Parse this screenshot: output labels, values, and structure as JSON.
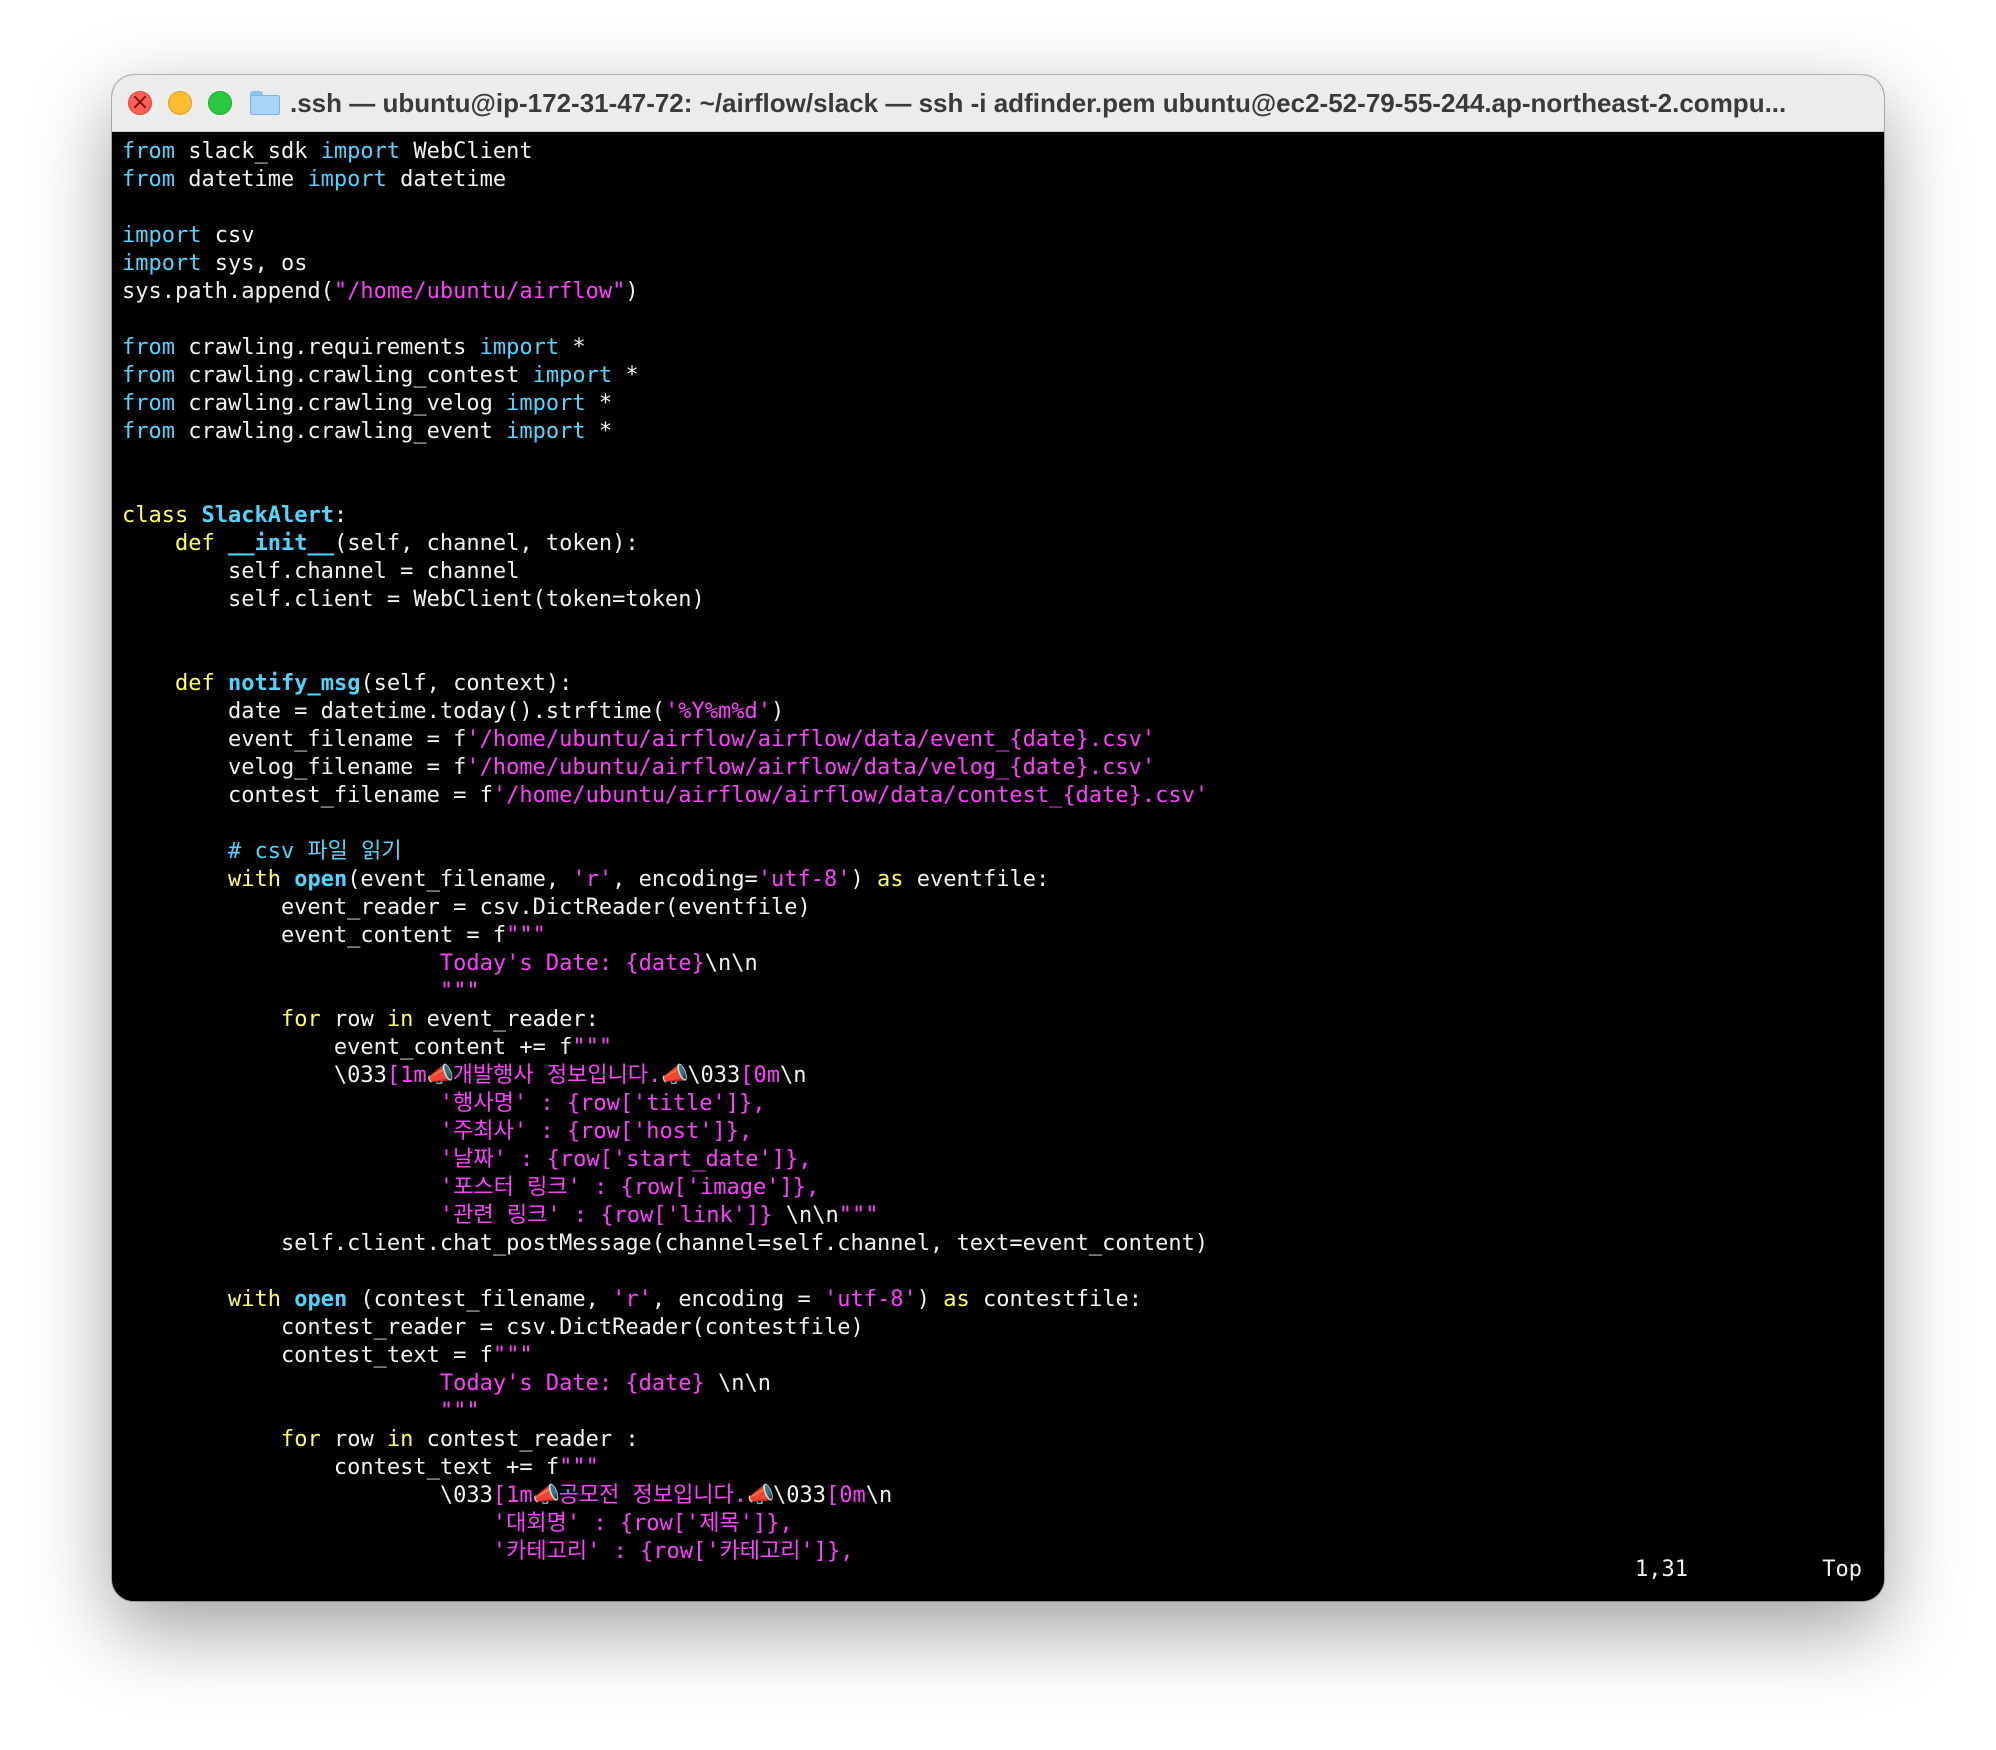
{
  "window": {
    "title": ".ssh — ubuntu@ip-172-31-47-72: ~/airflow/slack — ssh -i adfinder.pem ubuntu@ec2-52-79-55-244.ap-northeast-2.compu..."
  },
  "status": {
    "cursor": "1,31",
    "position": "Top"
  },
  "code": [
    [
      {
        "t": "from",
        "c": "kw"
      },
      {
        "t": " slack_sdk "
      },
      {
        "t": "import",
        "c": "kw"
      },
      {
        "t": " WebClient"
      }
    ],
    [
      {
        "t": "from",
        "c": "kw"
      },
      {
        "t": " datetime "
      },
      {
        "t": "import",
        "c": "kw"
      },
      {
        "t": " datetime"
      }
    ],
    [],
    [
      {
        "t": "import",
        "c": "kw"
      },
      {
        "t": " csv"
      }
    ],
    [
      {
        "t": "import",
        "c": "kw"
      },
      {
        "t": " sys, os"
      }
    ],
    [
      {
        "t": "sys.path.append("
      },
      {
        "t": "\"/home/ubuntu/airflow\"",
        "c": "str"
      },
      {
        "t": ")"
      }
    ],
    [],
    [
      {
        "t": "from",
        "c": "kw"
      },
      {
        "t": " crawling.requirements "
      },
      {
        "t": "import",
        "c": "kw"
      },
      {
        "t": " *"
      }
    ],
    [
      {
        "t": "from",
        "c": "kw"
      },
      {
        "t": " crawling.crawling_contest "
      },
      {
        "t": "import",
        "c": "kw"
      },
      {
        "t": " *"
      }
    ],
    [
      {
        "t": "from",
        "c": "kw"
      },
      {
        "t": " crawling.crawling_velog "
      },
      {
        "t": "import",
        "c": "kw"
      },
      {
        "t": " *"
      }
    ],
    [
      {
        "t": "from",
        "c": "kw"
      },
      {
        "t": " crawling.crawling_event "
      },
      {
        "t": "import",
        "c": "kw"
      },
      {
        "t": " *"
      }
    ],
    [],
    [],
    [
      {
        "t": "class",
        "c": "ky"
      },
      {
        "t": " "
      },
      {
        "t": "SlackAlert",
        "c": "cls"
      },
      {
        "t": ":"
      }
    ],
    [
      {
        "t": "    "
      },
      {
        "t": "def",
        "c": "ky"
      },
      {
        "t": " "
      },
      {
        "t": "__init__",
        "c": "cls"
      },
      {
        "t": "(self, channel, token):"
      }
    ],
    [
      {
        "t": "        self.channel = channel"
      }
    ],
    [
      {
        "t": "        self.client = WebClient(token=token)"
      }
    ],
    [],
    [],
    [
      {
        "t": "    "
      },
      {
        "t": "def",
        "c": "ky"
      },
      {
        "t": " "
      },
      {
        "t": "notify_msg",
        "c": "cls"
      },
      {
        "t": "(self, context):"
      }
    ],
    [
      {
        "t": "        date = datetime.today().strftime("
      },
      {
        "t": "'%Y%m%d'",
        "c": "str"
      },
      {
        "t": ")"
      }
    ],
    [
      {
        "t": "        event_filename = f"
      },
      {
        "t": "'/home/ubuntu/airflow/airflow/data/event_{date}.csv'",
        "c": "str"
      }
    ],
    [
      {
        "t": "        velog_filename = f"
      },
      {
        "t": "'/home/ubuntu/airflow/airflow/data/velog_{date}.csv'",
        "c": "str"
      }
    ],
    [
      {
        "t": "        contest_filename = f"
      },
      {
        "t": "'/home/ubuntu/airflow/airflow/data/contest_{date}.csv'",
        "c": "str"
      }
    ],
    [],
    [
      {
        "t": "        "
      },
      {
        "t": "# csv 파일 읽기",
        "c": "cm"
      }
    ],
    [
      {
        "t": "        "
      },
      {
        "t": "with",
        "c": "ky"
      },
      {
        "t": " "
      },
      {
        "t": "open",
        "c": "cls"
      },
      {
        "t": "(event_filename, "
      },
      {
        "t": "'r'",
        "c": "str"
      },
      {
        "t": ", encoding="
      },
      {
        "t": "'utf-8'",
        "c": "str"
      },
      {
        "t": ") "
      },
      {
        "t": "as",
        "c": "ky"
      },
      {
        "t": " eventfile:"
      }
    ],
    [
      {
        "t": "            event_reader = csv.DictReader(eventfile)"
      }
    ],
    [
      {
        "t": "            event_content = f"
      },
      {
        "t": "\"\"\"",
        "c": "str"
      }
    ],
    [
      {
        "t": "                        "
      },
      {
        "t": "Today's Date: {date}",
        "c": "str"
      },
      {
        "t": "\\n\\n"
      }
    ],
    [
      {
        "t": "                        "
      },
      {
        "t": "\"\"\"",
        "c": "str"
      }
    ],
    [
      {
        "t": "            "
      },
      {
        "t": "for",
        "c": "ky"
      },
      {
        "t": " row "
      },
      {
        "t": "in",
        "c": "ky"
      },
      {
        "t": " event_reader:"
      }
    ],
    [
      {
        "t": "                event_content += f"
      },
      {
        "t": "\"\"\"",
        "c": "str"
      }
    ],
    [
      {
        "t": "                \\033"
      },
      {
        "t": "[1m",
        "c": "str"
      },
      {
        "t": "📣",
        "c": "emoji"
      },
      {
        "t": "개발행사 정보입니다.",
        "c": "str"
      },
      {
        "t": "📣",
        "c": "emoji"
      },
      {
        "t": "\\033"
      },
      {
        "t": "[0m",
        "c": "str"
      },
      {
        "t": "\\n"
      }
    ],
    [
      {
        "t": "                        "
      },
      {
        "t": "'행사명' : {row['title']},",
        "c": "str"
      }
    ],
    [
      {
        "t": "                        "
      },
      {
        "t": "'주최사' : {row['host']},",
        "c": "str"
      }
    ],
    [
      {
        "t": "                        "
      },
      {
        "t": "'날짜' : {row['start_date']},",
        "c": "str"
      }
    ],
    [
      {
        "t": "                        "
      },
      {
        "t": "'포스터 링크' : {row['image']},",
        "c": "str"
      }
    ],
    [
      {
        "t": "                        "
      },
      {
        "t": "'관련 링크' : {row['link']}",
        "c": "str"
      },
      {
        "t": " \\n\\n"
      },
      {
        "t": "\"\"\"",
        "c": "str"
      }
    ],
    [
      {
        "t": "            self.client.chat_postMessage(channel=self.channel, text=event_content)"
      }
    ],
    [],
    [
      {
        "t": "        "
      },
      {
        "t": "with",
        "c": "ky"
      },
      {
        "t": " "
      },
      {
        "t": "open",
        "c": "cls"
      },
      {
        "t": " (contest_filename, "
      },
      {
        "t": "'r'",
        "c": "str"
      },
      {
        "t": ", encoding = "
      },
      {
        "t": "'utf-8'",
        "c": "str"
      },
      {
        "t": ") "
      },
      {
        "t": "as",
        "c": "ky"
      },
      {
        "t": " contestfile:"
      }
    ],
    [
      {
        "t": "            contest_reader = csv.DictReader(contestfile)"
      }
    ],
    [
      {
        "t": "            contest_text = f"
      },
      {
        "t": "\"\"\"",
        "c": "str"
      }
    ],
    [
      {
        "t": "                        "
      },
      {
        "t": "Today's Date: {date}",
        "c": "str"
      },
      {
        "t": " \\n\\n"
      }
    ],
    [
      {
        "t": "                        "
      },
      {
        "t": "\"\"\"",
        "c": "str"
      }
    ],
    [
      {
        "t": "            "
      },
      {
        "t": "for",
        "c": "ky"
      },
      {
        "t": " row "
      },
      {
        "t": "in",
        "c": "ky"
      },
      {
        "t": " contest_reader :"
      }
    ],
    [
      {
        "t": "                contest_text += f"
      },
      {
        "t": "\"\"\"",
        "c": "str"
      }
    ],
    [
      {
        "t": "                        \\033"
      },
      {
        "t": "[1m",
        "c": "str"
      },
      {
        "t": "📣",
        "c": "emoji"
      },
      {
        "t": "공모전 정보입니다.",
        "c": "str"
      },
      {
        "t": "📣",
        "c": "emoji"
      },
      {
        "t": "\\033"
      },
      {
        "t": "[0m",
        "c": "str"
      },
      {
        "t": "\\n"
      }
    ],
    [
      {
        "t": "                            "
      },
      {
        "t": "'대회명' : {row['제목']},",
        "c": "str"
      }
    ],
    [
      {
        "t": "                            "
      },
      {
        "t": "'카테고리' : {row['카테고리']},",
        "c": "str"
      }
    ]
  ]
}
